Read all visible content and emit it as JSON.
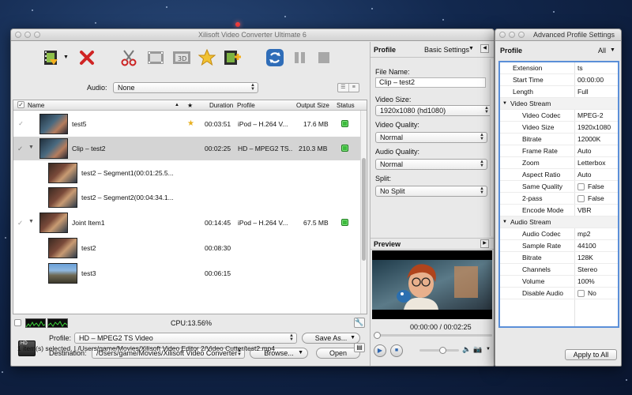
{
  "main_window": {
    "title": "Xilisoft Video Converter Ultimate 6"
  },
  "toolbar": {
    "buttons": [
      {
        "name": "add-file-button",
        "icon": "film-add-icon"
      },
      {
        "name": "remove-button",
        "icon": "red-x-icon"
      },
      {
        "name": "cut-button",
        "icon": "scissors-icon"
      },
      {
        "name": "merge-button",
        "icon": "film-strip-icon"
      },
      {
        "name": "3d-button",
        "icon": "3d-film-icon"
      },
      {
        "name": "effects-button",
        "icon": "star-icon"
      },
      {
        "name": "add-output-button",
        "icon": "film-plus-icon"
      },
      {
        "name": "convert-button",
        "icon": "convert-icon"
      },
      {
        "name": "pause-button",
        "icon": "pause-icon"
      },
      {
        "name": "stop-button",
        "icon": "stop-icon"
      }
    ]
  },
  "audio": {
    "label": "Audio:",
    "value": "None"
  },
  "file_list": {
    "columns": {
      "name": "Name",
      "star": "★",
      "duration": "Duration",
      "profile": "Profile",
      "output_size": "Output Size",
      "status": "Status"
    },
    "rows": [
      {
        "name": "test5",
        "starred": "★",
        "duration": "00:03:51",
        "profile": "iPod – H.264 V...",
        "size": "17.6 MB"
      },
      {
        "name": "Clip – test2",
        "duration": "00:02:25",
        "profile": "HD – MPEG2 TS...",
        "size": "210.3 MB"
      },
      {
        "name": "test2 – Segment1(00:01:25.5..."
      },
      {
        "name": "test2 – Segment2(00:04:34.1..."
      },
      {
        "name": "Joint Item1",
        "duration": "00:14:45",
        "profile": "iPod – H.264 V...",
        "size": "67.5 MB"
      },
      {
        "name": "test2",
        "duration": "00:08:30"
      },
      {
        "name": "test3",
        "duration": "00:06:15"
      }
    ]
  },
  "cpu": {
    "text": "CPU:13.56%"
  },
  "output": {
    "profile_label": "Profile:",
    "profile_value": "HD – MPEG2 TS Video",
    "save_as_label": "Save As...",
    "destination_label": "Destination:",
    "destination_value": "/Users/game/Movies/Xilisoft Video Converter",
    "browse_label": "Browse...",
    "open_label": "Open"
  },
  "status_bar": {
    "text": "1 item(s) selected. | /Users/game/Movies/Xilisoft Video Editor 2/Video Cutter/test2.mp4"
  },
  "profile_panel": {
    "title": "Profile",
    "basic_settings_label": "Basic Settings",
    "file_name_label": "File Name:",
    "file_name_value": "Clip – test2",
    "video_size_label": "Video Size:",
    "video_size_value": "1920x1080 (hd1080)",
    "video_quality_label": "Video Quality:",
    "video_quality_value": "Normal",
    "audio_quality_label": "Audio Quality:",
    "audio_quality_value": "Normal",
    "split_label": "Split:",
    "split_value": "No Split"
  },
  "preview": {
    "title": "Preview",
    "time": "00:00:00 / 00:02:25",
    "progress": 0.0,
    "volume": 0.6
  },
  "advanced": {
    "title": "Advanced Profile Settings",
    "profile_label": "Profile",
    "filter_value": "All",
    "apply_label": "Apply to All",
    "rows": [
      {
        "label": "Extension",
        "value": "ts",
        "indent": 1
      },
      {
        "label": "Start Time",
        "value": "00:00:00",
        "indent": 1
      },
      {
        "label": "Length",
        "value": "Full",
        "indent": 1
      },
      {
        "label": "Video Stream",
        "value": "",
        "indent": 0,
        "section": true
      },
      {
        "label": "Video Codec",
        "value": "MPEG-2",
        "indent": 2
      },
      {
        "label": "Video Size",
        "value": "1920x1080",
        "indent": 2
      },
      {
        "label": "Bitrate",
        "value": "12000K",
        "indent": 2
      },
      {
        "label": "Frame Rate",
        "value": "Auto",
        "indent": 2
      },
      {
        "label": "Zoom",
        "value": "Letterbox",
        "indent": 2
      },
      {
        "label": "Aspect Ratio",
        "value": "Auto",
        "indent": 2
      },
      {
        "label": "Same Quality",
        "value": "False",
        "indent": 2,
        "checkbox": true
      },
      {
        "label": "2-pass",
        "value": "False",
        "indent": 2,
        "checkbox": true
      },
      {
        "label": "Encode Mode",
        "value": "VBR",
        "indent": 2
      },
      {
        "label": "Audio Stream",
        "value": "",
        "indent": 0,
        "section": true
      },
      {
        "label": "Audio Codec",
        "value": "mp2",
        "indent": 2
      },
      {
        "label": "Sample Rate",
        "value": "44100",
        "indent": 2
      },
      {
        "label": "Bitrate",
        "value": "128K",
        "indent": 2
      },
      {
        "label": "Channels",
        "value": "Stereo",
        "indent": 2
      },
      {
        "label": "Volume",
        "value": "100%",
        "indent": 2
      },
      {
        "label": "Disable Audio",
        "value": "No",
        "indent": 2,
        "checkbox": true
      }
    ]
  },
  "colors": {
    "status_ok": "#3cbb3c",
    "selection": "#d4d4d4",
    "focus_border": "#5b8fd8"
  }
}
